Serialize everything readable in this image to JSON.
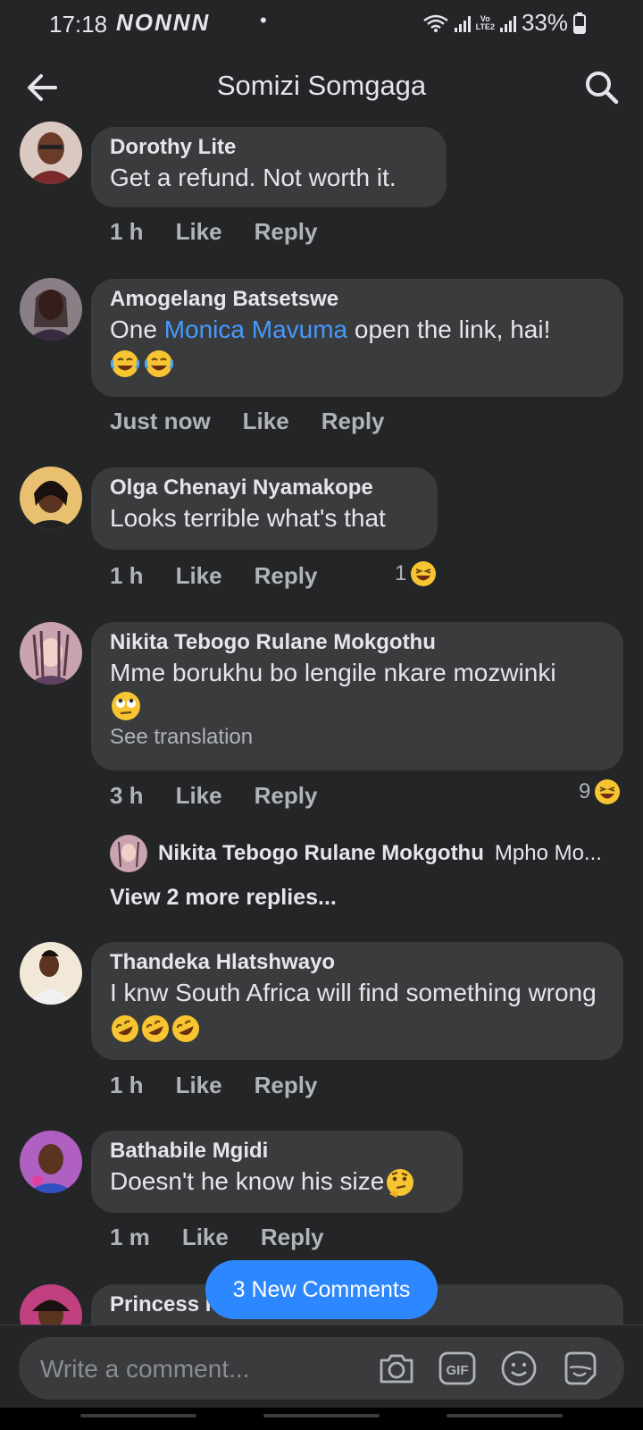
{
  "status": {
    "time": "17:18",
    "notifications": "NONNN",
    "dot": "•",
    "battery": "33%"
  },
  "header": {
    "title": "Somizi Somgaga",
    "back_icon": "arrow-left-icon",
    "search_icon": "search-icon"
  },
  "comments": [
    {
      "name": "Dorothy Lite",
      "text": "Get a refund. Not worth it.",
      "time": "1 h",
      "like": "Like",
      "reply": "Reply"
    },
    {
      "name": "Amogelang Batsetswe",
      "text_before": "One ",
      "mention": "Monica Mavuma",
      "text_after": " open the link, hai!",
      "time": "Just now",
      "like": "Like",
      "reply": "Reply"
    },
    {
      "name": "Olga Chenayi Nyamakope",
      "text": "Looks terrible what's that",
      "time": "1 h",
      "like": "Like",
      "reply": "Reply",
      "reaction_count": "1"
    },
    {
      "name": "Nikita Tebogo Rulane Mokgothu",
      "text": "Mme borukhu bo lengile nkare mozwinki",
      "see_translation": "See translation",
      "time": "3 h",
      "like": "Like",
      "reply": "Reply",
      "reaction_count": "9"
    },
    {
      "name": "Thandeka Hlatshwayo",
      "text": "I knw South Africa will find something wrong",
      "time": "1 h",
      "like": "Like",
      "reply": "Reply"
    },
    {
      "name": "Bathabile Mgidi",
      "text": "Doesn't he know his size",
      "time": "1 m",
      "like": "Like",
      "reply": "Reply"
    },
    {
      "name": "Princess I"
    }
  ],
  "reply_preview": {
    "name": "Nikita Tebogo Rulane Mokgothu",
    "text": "Mpho Mo..."
  },
  "view_more": "View 2 more replies...",
  "new_comments_label": "3 New Comments",
  "composer": {
    "placeholder": "Write a comment...",
    "icons": [
      "camera-icon",
      "gif-icon",
      "emoji-icon",
      "sticker-icon"
    ]
  },
  "colors": {
    "background": "#242526",
    "bubble": "#3a3b3c",
    "link": "#4599ff",
    "accent": "#2d88ff"
  }
}
